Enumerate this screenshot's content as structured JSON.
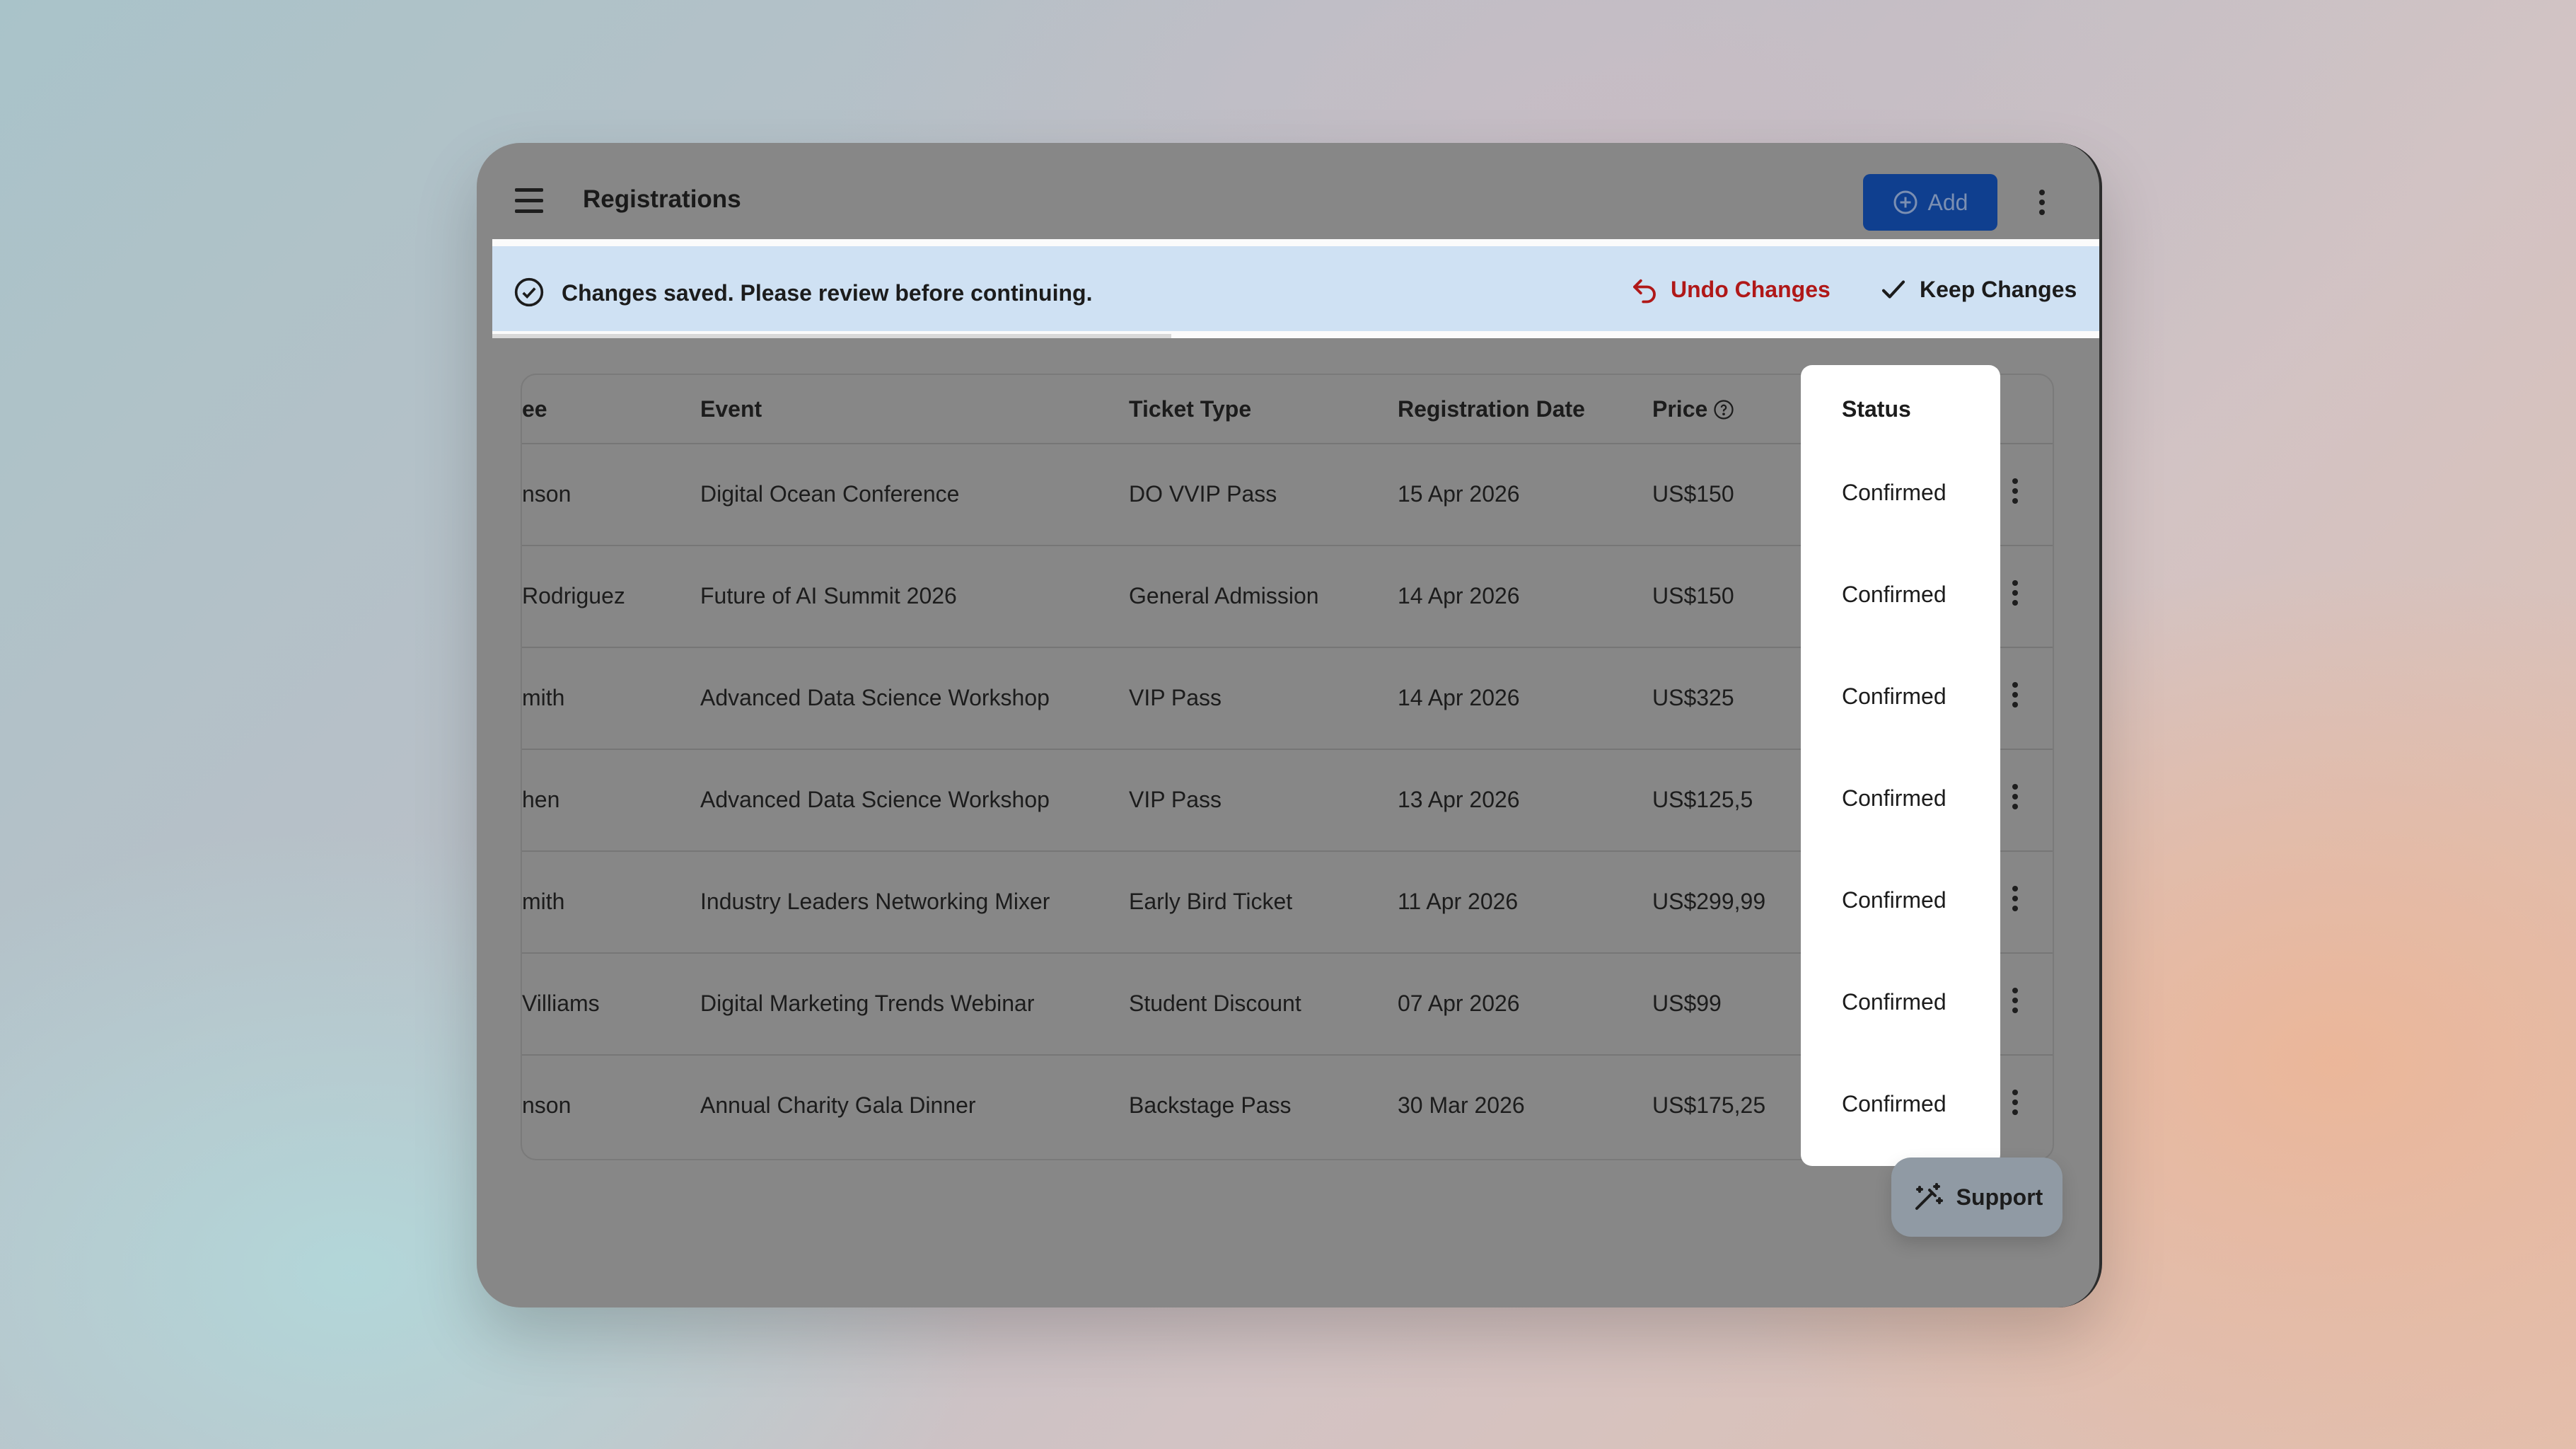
{
  "header": {
    "title": "Registrations",
    "add_label": "Add"
  },
  "banner": {
    "message": "Changes saved. Please review before continuing.",
    "undo_label": "Undo Changes",
    "keep_label": "Keep Changes"
  },
  "table": {
    "columns": [
      "ee",
      "Event",
      "Ticket Type",
      "Registration Date",
      "Price",
      "Status"
    ],
    "rows": [
      {
        "attendee": "nson",
        "event": "Digital Ocean Conference",
        "ticket": "DO VVIP Pass",
        "date": "15 Apr 2026",
        "price": "US$150",
        "status": "Confirmed"
      },
      {
        "attendee": "Rodriguez",
        "event": "Future of AI Summit 2026",
        "ticket": "General Admission",
        "date": "14 Apr 2026",
        "price": "US$150",
        "status": "Confirmed"
      },
      {
        "attendee": "mith",
        "event": "Advanced Data Science Workshop",
        "ticket": "VIP Pass",
        "date": "14 Apr 2026",
        "price": "US$325",
        "status": "Confirmed"
      },
      {
        "attendee": "hen",
        "event": "Advanced Data Science Workshop",
        "ticket": "VIP Pass",
        "date": "13 Apr 2026",
        "price": "US$125,5",
        "status": "Confirmed"
      },
      {
        "attendee": "mith",
        "event": "Industry Leaders Networking Mixer",
        "ticket": "Early Bird Ticket",
        "date": "11 Apr 2026",
        "price": "US$299,99",
        "status": "Confirmed"
      },
      {
        "attendee": "Villiams",
        "event": "Digital Marketing Trends Webinar",
        "ticket": "Student Discount",
        "date": "07 Apr 2026",
        "price": "US$99",
        "status": "Confirmed"
      },
      {
        "attendee": "nson",
        "event": "Annual Charity Gala Dinner",
        "ticket": "Backstage Pass",
        "date": "30 Mar 2026",
        "price": "US$175,25",
        "status": "Confirmed"
      }
    ]
  },
  "support": {
    "label": "Support"
  },
  "icons": [
    "menu-icon",
    "plus-circle-icon",
    "more-vertical-icon",
    "check-circle-icon",
    "undo-icon",
    "check-icon",
    "help-circle-icon",
    "magic-wand-icon"
  ]
}
